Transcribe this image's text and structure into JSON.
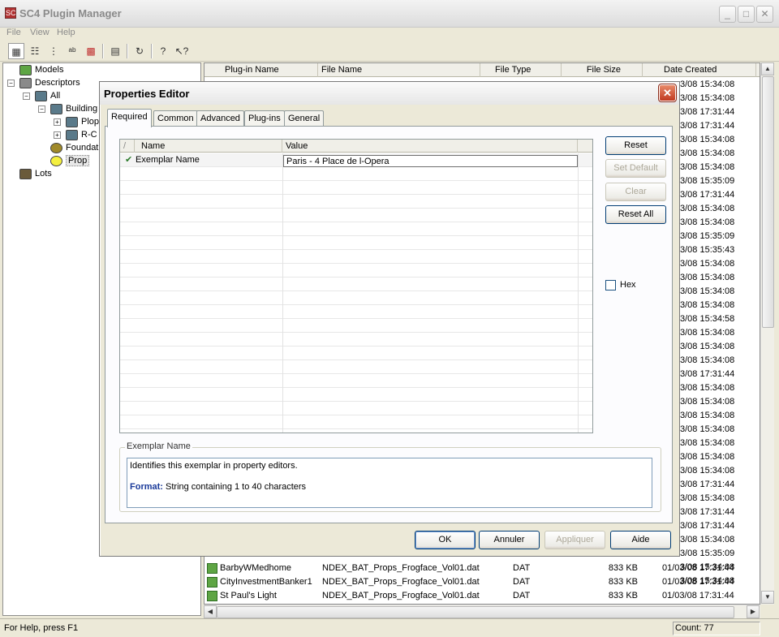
{
  "app": {
    "title": "SC4 Plugin Manager",
    "icon_text": "SC",
    "window_buttons": {
      "minimize": "_",
      "maximize": "□",
      "close": "✕"
    }
  },
  "menu": [
    "File",
    "View",
    "Help"
  ],
  "toolbar": [
    {
      "name": "large-icons-view",
      "glyph": "▦"
    },
    {
      "name": "details-view",
      "glyph": "☷"
    },
    {
      "name": "tree-view",
      "glyph": "⋮"
    },
    {
      "name": "sort-view",
      "glyph": "ᵃᵇ"
    },
    {
      "name": "color-grid-view",
      "glyph": "▩"
    },
    {
      "name": "properties",
      "glyph": "▤"
    },
    {
      "name": "refresh",
      "glyph": "↻"
    },
    {
      "name": "help",
      "glyph": "?"
    },
    {
      "name": "context-help",
      "glyph": "↖?"
    }
  ],
  "tree": [
    {
      "label": "Models",
      "indent": 0,
      "expander": null,
      "icon": "#5ea544"
    },
    {
      "label": "Descriptors",
      "indent": 0,
      "expander": "−",
      "icon": "#8a8a8a"
    },
    {
      "label": "All",
      "indent": 1,
      "expander": "−",
      "icon": "#5a7a8a"
    },
    {
      "label": "Building",
      "indent": 2,
      "expander": "−",
      "icon": "#5a7a8a"
    },
    {
      "label": "Plop",
      "indent": 3,
      "expander": "+",
      "icon": "#5a7a8a"
    },
    {
      "label": "R-C",
      "indent": 3,
      "expander": "+",
      "icon": "#5a7a8a"
    },
    {
      "label": "Foundat",
      "indent": 2,
      "expander": null,
      "icon": "#a08a2a"
    },
    {
      "label": "Prop",
      "indent": 2,
      "expander": null,
      "icon": "#f4f040",
      "selected": true
    },
    {
      "label": "Lots",
      "indent": 0,
      "expander": null,
      "icon": "#6a5a3a"
    }
  ],
  "list": {
    "columns": [
      "Plug-in Name",
      "File Name",
      "File Type",
      "File Size",
      "Date Created"
    ],
    "dates_visible": [
      "3/08 15:34:08",
      "3/08 15:34:08",
      "3/08 17:31:44",
      "3/08 17:31:44",
      "3/08 15:34:08",
      "3/08 15:34:08",
      "3/08 15:34:08",
      "3/08 15:35:09",
      "3/08 17:31:44",
      "3/08 15:34:08",
      "3/08 15:34:08",
      "3/08 15:35:09",
      "3/08 15:35:43",
      "3/08 15:34:08",
      "3/08 15:34:08",
      "3/08 15:34:08",
      "3/08 15:34:08",
      "3/08 15:34:58",
      "3/08 15:34:08",
      "3/08 15:34:08",
      "3/08 15:34:08",
      "3/08 17:31:44",
      "3/08 15:34:08",
      "3/08 15:34:08",
      "3/08 15:34:08",
      "3/08 15:34:08",
      "3/08 15:34:08",
      "3/08 15:34:08",
      "3/08 15:34:08",
      "3/08 17:31:44",
      "3/08 15:34:08",
      "3/08 17:31:44",
      "3/08 17:31:44",
      "3/08 15:34:08",
      "3/08 15:35:09",
      "3/08 15:34:08",
      "3/08 15:34:08"
    ],
    "rows": [
      {
        "name": "BarbyWMedhome",
        "file": "NDEX_BAT_Props_Frogface_Vol01.dat",
        "type": "DAT",
        "size": "833 KB",
        "date": "01/03/08 17:31:44"
      },
      {
        "name": "CityInvestmentBanker1",
        "file": "NDEX_BAT_Props_Frogface_Vol01.dat",
        "type": "DAT",
        "size": "833 KB",
        "date": "01/03/08 17:31:44"
      },
      {
        "name": "St Paul's Light",
        "file": "NDEX_BAT_Props_Frogface_Vol01.dat",
        "type": "DAT",
        "size": "833 KB",
        "date": "01/03/08 17:31:44"
      }
    ]
  },
  "status": {
    "help_text": "For Help, press F1",
    "count": "Count: 77"
  },
  "dialog": {
    "title": "Properties Editor",
    "close": "✕",
    "tabs": [
      "Required",
      "Common",
      "Advanced",
      "Plug-ins",
      "General"
    ],
    "active_tab": "Required",
    "grid": {
      "headers": [
        "/",
        "Name",
        "Value"
      ],
      "rows": [
        {
          "check": "✔",
          "name": "Exemplar Name",
          "value": "Paris - 4 Place de l-Opera"
        }
      ]
    },
    "side_buttons": [
      {
        "label": "Reset",
        "enabled": true
      },
      {
        "label": "Set Default",
        "enabled": false
      },
      {
        "label": "Clear",
        "enabled": false
      },
      {
        "label": "Reset All",
        "enabled": true
      }
    ],
    "hex_label": "Hex",
    "description": {
      "title": "Exemplar Name",
      "text": "Identifies this exemplar in property editors.",
      "format_label": "Format:",
      "format_text": " String containing 1 to 40 characters"
    },
    "buttons": [
      {
        "label": "OK",
        "enabled": true
      },
      {
        "label": "Annuler",
        "enabled": true
      },
      {
        "label": "Appliquer",
        "enabled": false
      },
      {
        "label": "Aide",
        "enabled": true
      }
    ]
  }
}
